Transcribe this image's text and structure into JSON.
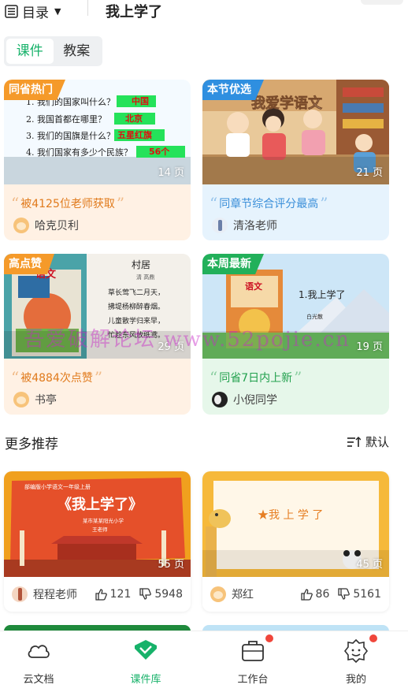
{
  "header": {
    "menu_label": "目录",
    "title": "我上学了"
  },
  "tabs": [
    {
      "label": "课件",
      "active": true
    },
    {
      "label": "教案",
      "active": false
    }
  ],
  "featured": [
    {
      "badge": "同省热门",
      "pages": "14 页",
      "quote": "被4125位老师获取",
      "author": "哈克贝利",
      "theme": "orange",
      "thumb_lines": [
        "1. 我们的国家叫什么？",
        "2. 我国首都在哪里？",
        "3. 我们的国旗是什么？",
        "4. 我们国家有多少个民族？"
      ],
      "thumb_answers": [
        "中国",
        "北京",
        "五星红旗",
        "56个"
      ]
    },
    {
      "badge": "本节优选",
      "pages": "21 页",
      "quote": "同章节综合评分最高",
      "author": "清洛老师",
      "theme": "blue",
      "thumb_title": "我爱学语文"
    },
    {
      "badge": "高点赞",
      "pages": "29 页",
      "quote": "被4884次点赞",
      "author": "书亭",
      "theme": "orange",
      "thumb_title": "村居",
      "thumb_sub": "清  高鼎",
      "thumb_lines": [
        "草长莺飞二月天，",
        "拂堤杨柳醉春烟。",
        "儿童散学归来早，",
        "忙趁东风放纸鸢。"
      ],
      "book_label": "语文"
    },
    {
      "badge": "本周最新",
      "pages": "19 页",
      "quote": "同省7日内上新",
      "author": "小倪同学",
      "theme": "green",
      "thumb_title": "1.我上学了",
      "thumb_sub": "白光散",
      "book_label": "语文"
    }
  ],
  "section": {
    "title": "更多推荐",
    "sort_label": "默认"
  },
  "recommend": [
    {
      "pages": "55 页",
      "author": "程程老师",
      "likes": "121",
      "downloads": "5948",
      "thumb_title": "《我上学了》",
      "thumb_top": "部编版小学语文一年级上册",
      "thumb_sub": "某市某某阳光小学",
      "thumb_sub2": "王老师"
    },
    {
      "pages": "45 页",
      "author": "郑红",
      "likes": "86",
      "downloads": "5161",
      "thumb_title": "★我 上 学 了"
    }
  ],
  "nav": [
    {
      "label": "云文档",
      "icon": "cloud-icon",
      "active": false,
      "dot": false
    },
    {
      "label": "课件库",
      "icon": "courseware-icon",
      "active": true,
      "dot": false
    },
    {
      "label": "工作台",
      "icon": "briefcase-icon",
      "active": false,
      "dot": true
    },
    {
      "label": "我的",
      "icon": "profile-icon",
      "active": false,
      "dot": true
    }
  ],
  "watermark": "吾爱破解论坛  www.52pojie.cn",
  "colors": {
    "accent": "#17b26a",
    "orange": "#e07a1c",
    "blue": "#3a8fd9",
    "green": "#21a04d",
    "red_dot": "#f0463b"
  }
}
